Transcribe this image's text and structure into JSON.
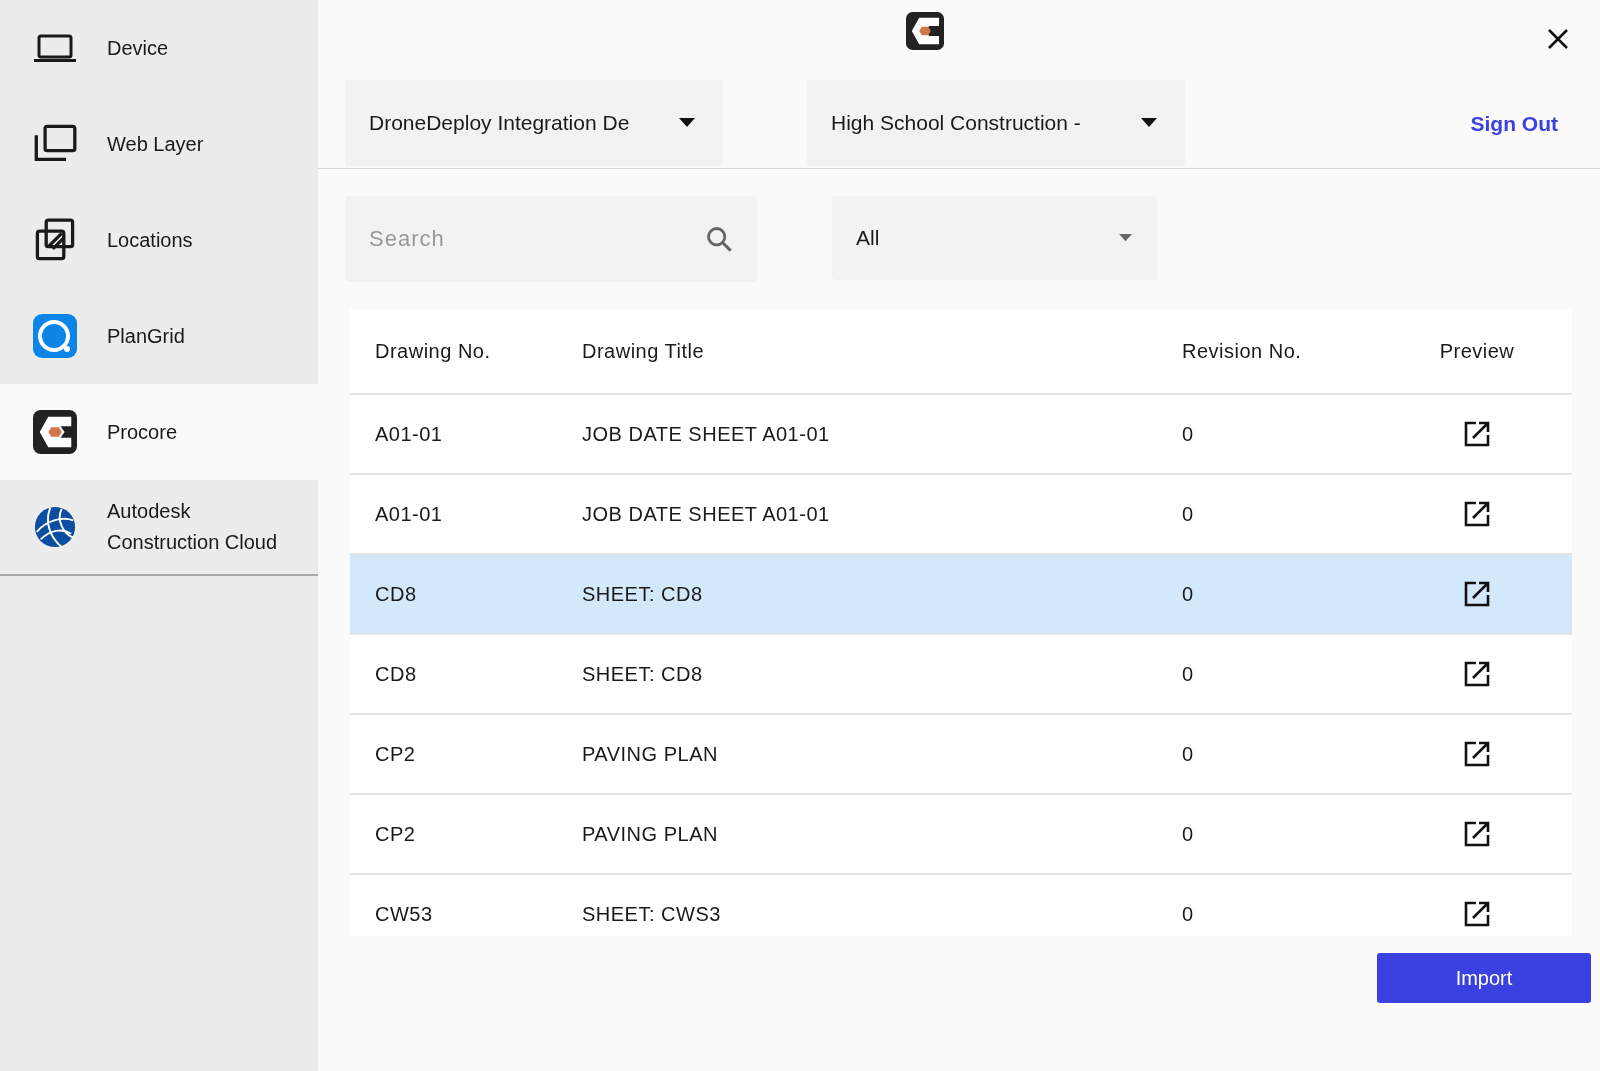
{
  "sidebar": {
    "items": [
      {
        "label": "Device",
        "selected": false
      },
      {
        "label": "Web Layer",
        "selected": false
      },
      {
        "label": "Locations",
        "selected": false
      },
      {
        "label": "PlanGrid",
        "selected": false
      },
      {
        "label": "Procore",
        "selected": true
      },
      {
        "label": "Autodesk Construction Cloud",
        "selected": false
      }
    ]
  },
  "header": {
    "company_dropdown": "DroneDeploy Integration De",
    "project_dropdown": "High School Construction -",
    "sign_out": "Sign Out"
  },
  "filters": {
    "search": {
      "placeholder": "Search"
    },
    "type_dropdown": "All"
  },
  "table": {
    "columns": [
      "Drawing No.",
      "Drawing Title",
      "Revision No.",
      "Preview"
    ],
    "rows": [
      {
        "number": "A01-01",
        "title": "JOB DATE SHEET A01-01",
        "revision": "0",
        "selected": false
      },
      {
        "number": "A01-01",
        "title": "JOB DATE SHEET A01-01",
        "revision": "0",
        "selected": false
      },
      {
        "number": "CD8",
        "title": "SHEET: CD8",
        "revision": "0",
        "selected": true
      },
      {
        "number": "CD8",
        "title": "SHEET: CD8",
        "revision": "0",
        "selected": false
      },
      {
        "number": "CP2",
        "title": "PAVING PLAN",
        "revision": "0",
        "selected": false
      },
      {
        "number": "CP2",
        "title": "PAVING PLAN",
        "revision": "0",
        "selected": false
      },
      {
        "number": "CW53",
        "title": "SHEET: CWS3",
        "revision": "0",
        "selected": false
      }
    ]
  },
  "import_button": "Import"
}
